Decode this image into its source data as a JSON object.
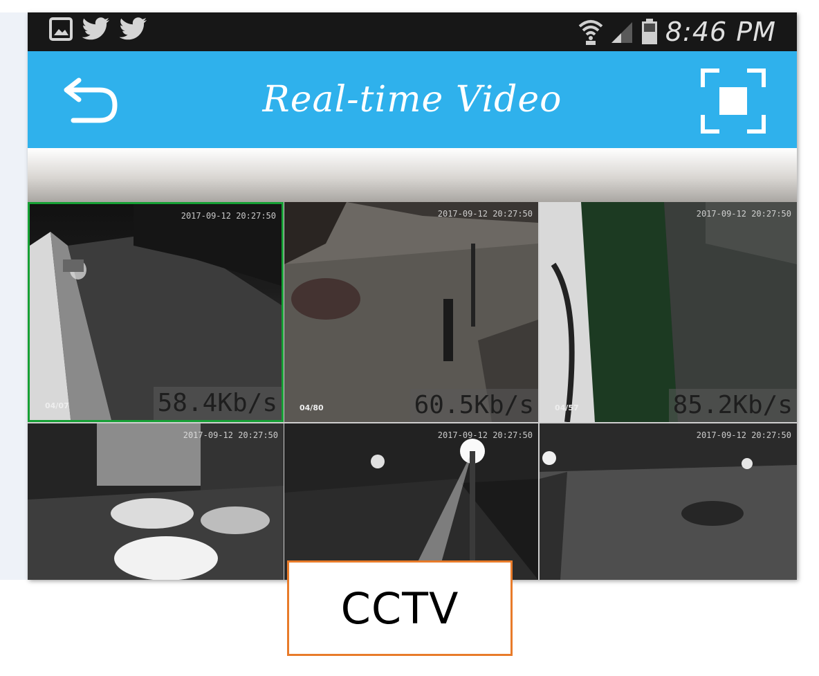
{
  "status_bar": {
    "left_icons": [
      "image-icon",
      "twitter-icon",
      "twitter-icon"
    ],
    "right_icons": [
      "wifi-icon",
      "signal-icon",
      "battery-icon"
    ],
    "time": "8:46 PM"
  },
  "app_bar": {
    "title": "Real-time Video",
    "back_icon": "back-arrow-icon",
    "fullscreen_icon": "fullscreen-icon",
    "color": "#2fb1ec"
  },
  "cameras": [
    {
      "timestamp": "2017-09-12 20:27:50",
      "name": "04/07",
      "rate": "58.4Kb/s",
      "selected": true
    },
    {
      "timestamp": "2017-09-12 20:27:50",
      "name": "04/80",
      "rate": "60.5Kb/s",
      "selected": false
    },
    {
      "timestamp": "2017-09-12 20:27:50",
      "name": "04/57",
      "rate": "85.2Kb/s",
      "selected": false
    },
    {
      "timestamp": "2017-09-12 20:27:50",
      "name": "",
      "rate": "",
      "selected": false
    },
    {
      "timestamp": "2017-09-12 20:27:50",
      "name": "",
      "rate": "",
      "selected": false
    },
    {
      "timestamp": "2017-09-12 20:27:50",
      "name": "",
      "rate": "",
      "selected": false
    }
  ],
  "caption": {
    "text": "CCTV",
    "border_color": "#e87b2a"
  },
  "colors": {
    "selected_border": "#16a035"
  }
}
